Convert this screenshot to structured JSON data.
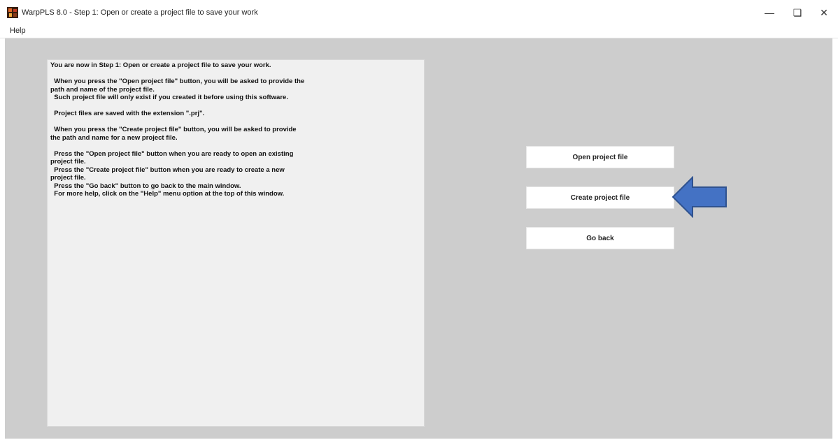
{
  "window": {
    "title": "WarpPLS 8.0 - Step 1: Open or create a project file to save your work",
    "controls": {
      "minimize": "—",
      "maximize": "❏",
      "close": "✕"
    }
  },
  "menubar": {
    "items": [
      "Help"
    ]
  },
  "info_panel": {
    "text": "You are now in Step 1: Open or create a project file to save your work.\n\n  When you press the \"Open project file\" button, you will be asked to provide the\npath and name of the project file.\n  Such project file will only exist if you created it before using this software.\n\n  Project files are saved with the extension \".prj\".\n\n  When you press the \"Create project file\" button, you will be asked to provide\nthe path and name for a new project file.\n\n  Press the \"Open project file\" button when you are ready to open an existing\nproject file.\n  Press the \"Create project file\" button when you are ready to create a new\nproject file.\n  Press the \"Go back\" button to go back to the main window.\n  For more help, click on the \"Help\" menu option at the top of this window."
  },
  "buttons": {
    "open_project": "Open project file",
    "create_project": "Create project file",
    "go_back": "Go back"
  },
  "colors": {
    "client_background": "#cdcdcd",
    "panel_background": "#f0f0f0",
    "arrow_fill": "#4472c4",
    "arrow_stroke": "#2f528f"
  },
  "icons": {
    "app": "warppls-app-icon",
    "pointer": "blue-arrow-pointer-icon"
  }
}
